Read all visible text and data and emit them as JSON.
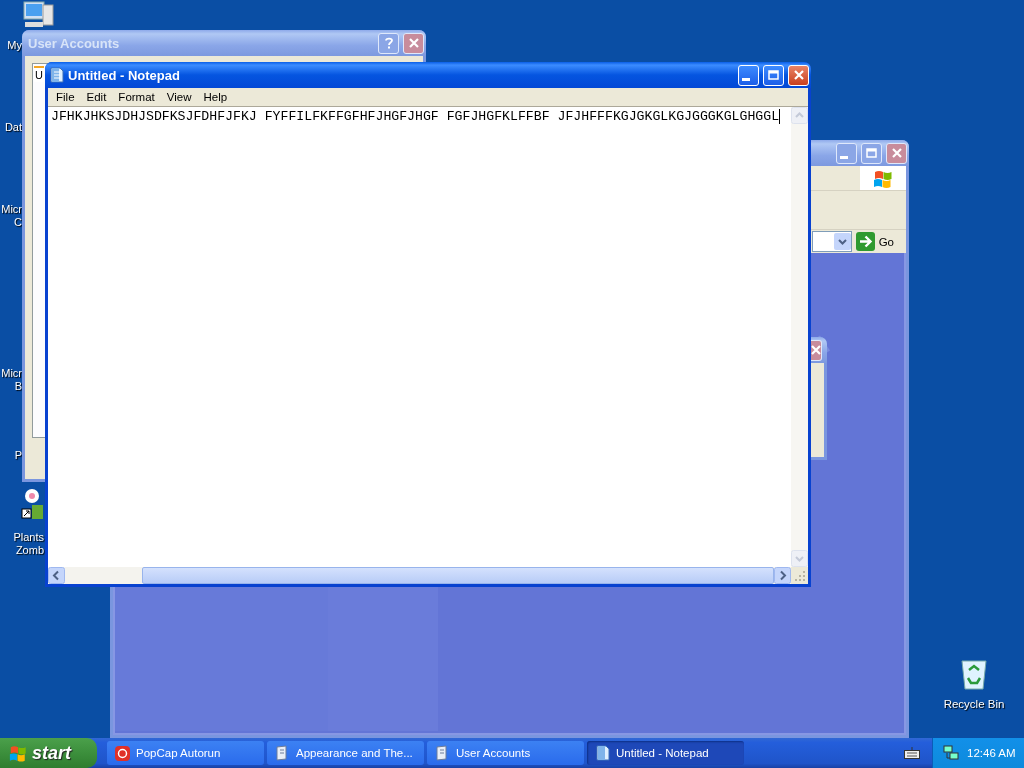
{
  "desktop": {
    "icons": [
      {
        "kind": "computer",
        "lines": [
          "My"
        ]
      },
      {
        "kind": "covered",
        "lines": [
          "Dat"
        ]
      },
      {
        "kind": "covered",
        "lines": [
          "Micr",
          "C"
        ]
      },
      {
        "kind": "covered",
        "lines": [
          "Micr",
          "B"
        ]
      },
      {
        "kind": "covered",
        "lines": [
          "P"
        ]
      },
      {
        "kind": "shortcut",
        "lines": [
          "Plants",
          "Zomb"
        ]
      }
    ],
    "recycle_bin": {
      "label": "Recycle Bin"
    }
  },
  "windows": [
    {
      "kind": "user_accounts",
      "title": "User Accounts",
      "active": false,
      "tab_label": "U"
    },
    {
      "kind": "explorer",
      "active": false,
      "go_label": "Go"
    },
    {
      "kind": "dialog",
      "active": false
    },
    {
      "kind": "notepad",
      "title": "Untitled - Notepad",
      "active": true,
      "menu": [
        "File",
        "Edit",
        "Format",
        "View",
        "Help"
      ],
      "text": "JFHKJHKSJDHJSDFKSJFDHFJFKJ FYFFILFKFFGFHFJHGFJHGF FGFJHGFKLFFBF JFJHFFFKGJGKGLKGJGGGKGLGHGGL"
    }
  ],
  "taskbar": {
    "start_label": "start",
    "tasks": [
      {
        "kind": "popcap",
        "label": "PopCap Autorun",
        "selected": false
      },
      {
        "kind": "folder",
        "label": "Appearance and The...",
        "selected": false
      },
      {
        "kind": "folder",
        "label": "User Accounts",
        "selected": false
      },
      {
        "kind": "notepad",
        "label": "Untitled - Notepad",
        "selected": true
      }
    ],
    "clock": "12:46 AM"
  }
}
